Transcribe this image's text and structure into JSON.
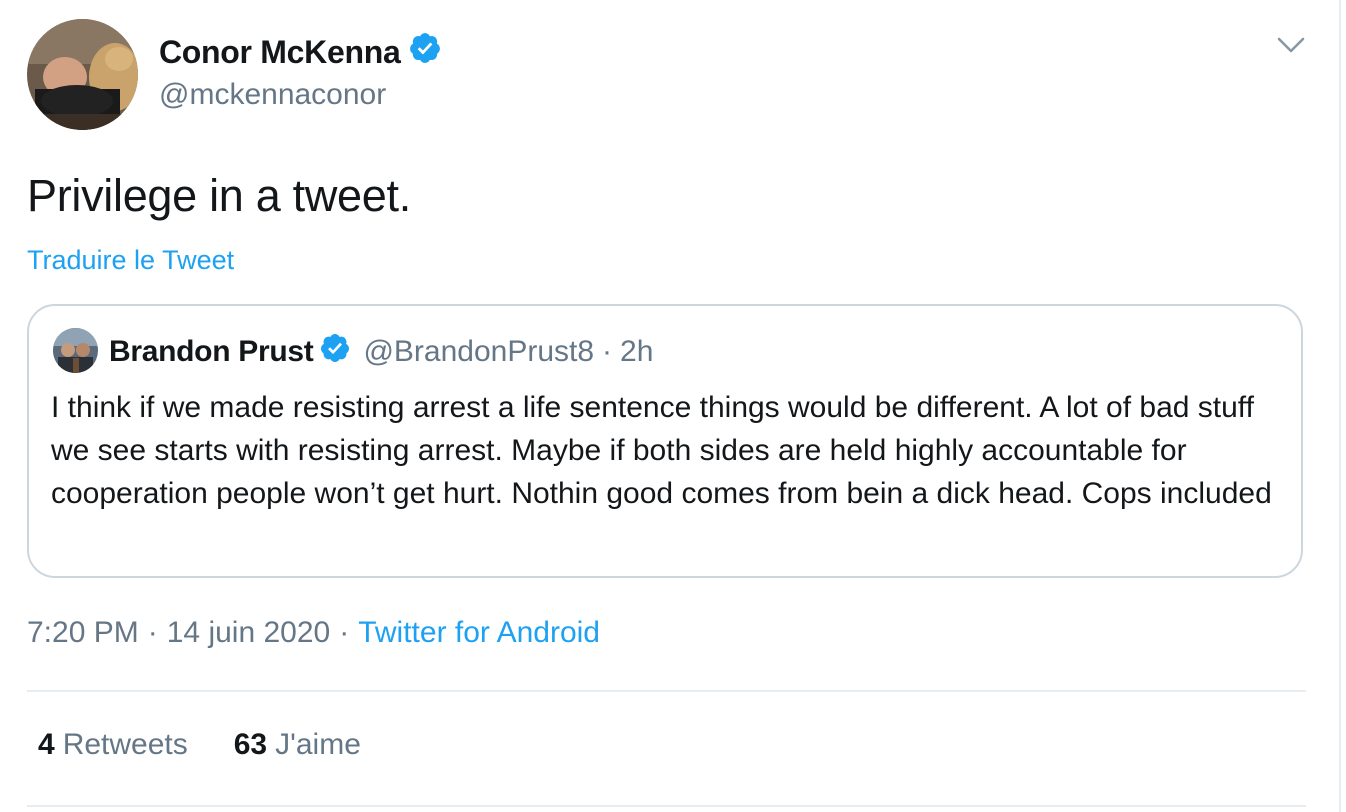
{
  "tweet": {
    "author": {
      "name": "Conor McKenna",
      "handle": "@mckennaconor",
      "verified": true
    },
    "text": "Privilege in a tweet.",
    "translate_label": "Traduire le Tweet",
    "quoted": {
      "author_name": "Brandon Prust",
      "handle": "@BrandonPrust8",
      "separator": "·",
      "age": "2h",
      "verified": true,
      "text": "I think if we made resisting arrest a life sentence things would be different. A lot of bad stuff we see starts with resisting arrest. Maybe if both sides are held highly accountable for cooperation people won’t get hurt. Nothin good comes from bein a dick head. Cops included"
    },
    "meta": {
      "time": "7:20 PM",
      "separator": "·",
      "date": "14 juin 2020",
      "source": "Twitter for Android"
    },
    "stats": {
      "retweets_count": "4",
      "retweets_label": "Retweets",
      "likes_count": "63",
      "likes_label": "J'aime"
    }
  },
  "colors": {
    "accent": "#1da1f2",
    "secondary_text": "#657786",
    "primary_text": "#14171a",
    "border": "#ccd6dd",
    "divider": "#e6ecf0"
  },
  "icons": {
    "verified": "verified-badge-icon",
    "caret": "chevron-down-icon"
  }
}
